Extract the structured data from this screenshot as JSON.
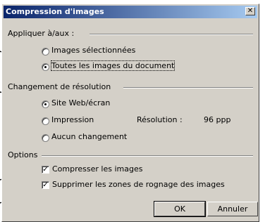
{
  "dialog": {
    "title": "Compression d'images",
    "close_glyph": "✕"
  },
  "apply_group": {
    "label": "Appliquer à/aux :",
    "options": [
      {
        "label": "Images sélectionnées",
        "checked": false
      },
      {
        "label": "Toutes les images du document",
        "checked": true
      }
    ]
  },
  "resolution_group": {
    "label": "Changement de résolution",
    "options": [
      {
        "label": "Site Web/écran",
        "checked": true
      },
      {
        "label": "Impression",
        "checked": false
      },
      {
        "label": "Aucun changement",
        "checked": false
      }
    ],
    "resolution_label": "Résolution :",
    "resolution_value": "96 ppp"
  },
  "options_group": {
    "label": "Options",
    "checkboxes": [
      {
        "label": "Compresser les images",
        "checked": true
      },
      {
        "label": "Supprimer les zones de rognage des images",
        "checked": true
      }
    ]
  },
  "buttons": {
    "ok": "OK",
    "cancel": "Annuler"
  },
  "glyphs": {
    "check": "✓"
  }
}
